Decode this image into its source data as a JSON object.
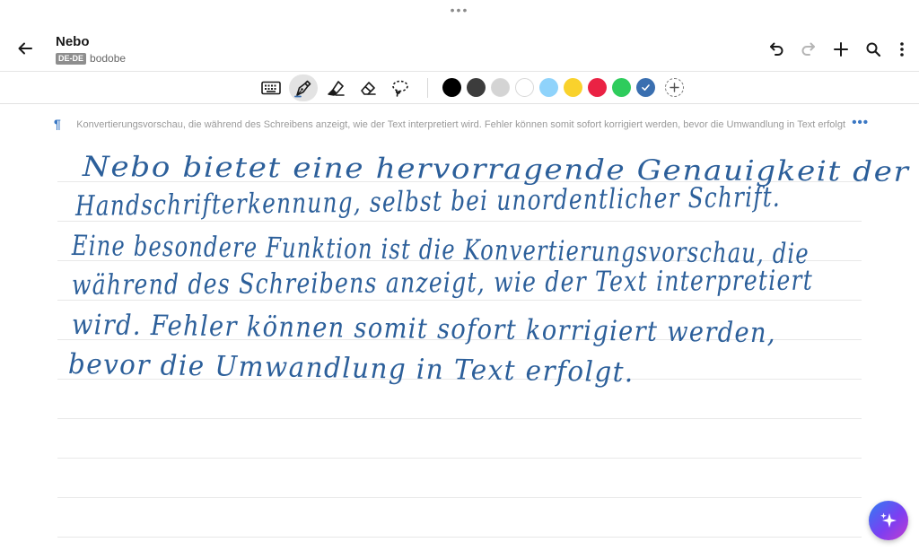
{
  "header": {
    "title": "Nebo",
    "language_badge": "DE-DE",
    "subtitle": "bodobe"
  },
  "icons": {
    "back": "arrow-left-icon",
    "undo": "undo-icon",
    "redo": "redo-icon",
    "add": "plus-icon",
    "search": "search-icon",
    "more": "more-vertical-icon",
    "keyboard": "keyboard-icon",
    "pen": "pen-icon",
    "highlighter": "highlighter-icon",
    "eraser": "eraser-icon",
    "lasso": "lasso-icon",
    "assistant": "sparkle-icon"
  },
  "toolbar": {
    "active_tool": "pen",
    "colors": [
      "#000000",
      "#3c3c3c",
      "#d4d4d4",
      "#ffffff",
      "#8fd3fb",
      "#f9d22c",
      "#ea2244",
      "#2ecc5c",
      "#3a6fb0"
    ],
    "selected_color": "#3a6fb0"
  },
  "preview": {
    "text": "Nebo bietet eine hervorragende Genauigkeit der Handschrifterkennung, selbst bei unordentlicher Schrift. Eine besondere Funktion ist die Konvertierungsvorschau, die während des Schreibens anzeigt, wie der Text interpretiert wird. Fehler können somit sofort korrigiert werden, bevor die Umwandlung in Text erfolgt",
    "more_label": "•••"
  },
  "handwriting": {
    "ink_color": "#2c5f9a",
    "lines": [
      "Nebo bietet eine hervorragende Genauigkeit der",
      "Handschrifterkennung, selbst bei unordentlicher Schrift.",
      "Eine besondere Funktion ist die Konvertierungsvorschau, die",
      "während des Schreibens anzeigt, wie der Text interpretiert",
      "wird. Fehler können somit sofort korrigiert werden,",
      "bevor die Umwandlung in Text erfolgt."
    ]
  }
}
